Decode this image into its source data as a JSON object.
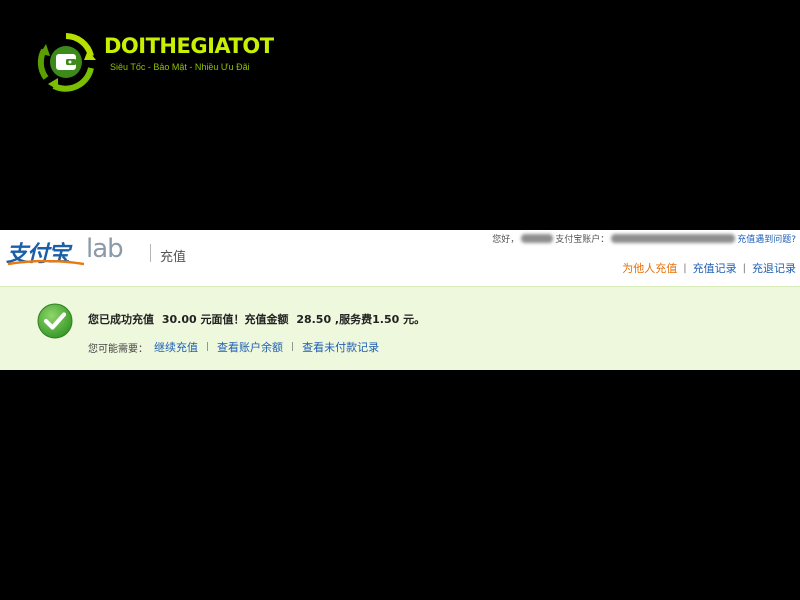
{
  "watermark": {
    "title": "DOITHEGIATOT",
    "slogan": "Siêu Tốc - Bảo Mật - Nhiều Ưu Đãi"
  },
  "header": {
    "brand_name": "支付宝",
    "brand_lab": "lab",
    "section_title": "充值",
    "greeting": "您好，",
    "account_label": "支付宝账户：",
    "help_link": "充值遇到问题?"
  },
  "nav_links": [
    {
      "label": "为他人充值",
      "color": "#e8700a"
    },
    {
      "label": "充值记录",
      "color": "#1f5fb5"
    },
    {
      "label": "充退记录",
      "color": "#1f5fb5"
    }
  ],
  "result": {
    "message_parts": [
      "您已成功充值",
      "30.00 元面值！充值金额",
      "28.50 ,服务费1.50 元。"
    ],
    "next_label": "您可能需要：",
    "actions": [
      {
        "label": "继续充值"
      },
      {
        "label": "查看账户余额"
      },
      {
        "label": "查看未付款记录"
      }
    ]
  },
  "colors": {
    "background": "#000000",
    "strip_background": "#ffffff",
    "success_panel": "#eef8dd",
    "link_blue": "#1f5fb5",
    "link_orange": "#e8700a",
    "watermark_green": "#c8f000",
    "check_green": "#4aa83a"
  },
  "icons": {
    "watermark": "wallet-recycle-icon",
    "success": "checkmark-circle-icon"
  }
}
